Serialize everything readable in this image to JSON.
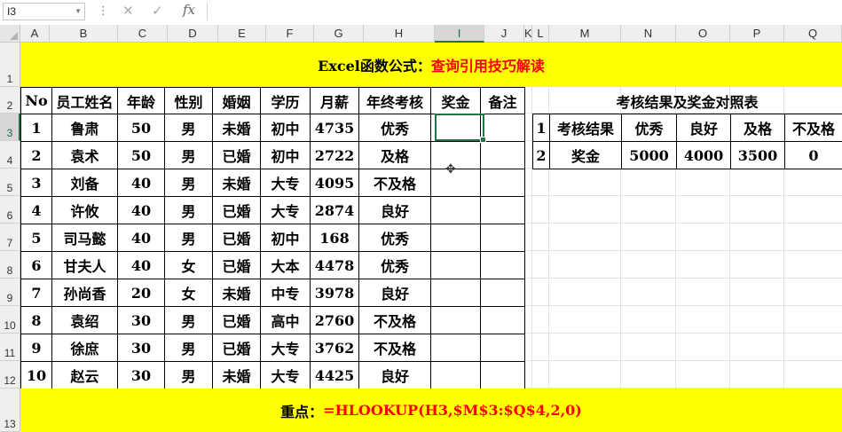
{
  "formula_bar": {
    "name_box": "I3",
    "cancel_glyph": "✕",
    "enter_glyph": "✓",
    "fx_glyph": "fx",
    "formula": ""
  },
  "columns": [
    "A",
    "B",
    "C",
    "D",
    "E",
    "F",
    "G",
    "H",
    "I",
    "J",
    "K",
    "L",
    "M",
    "N",
    "O",
    "P",
    "Q"
  ],
  "selected_column": "I",
  "rows": [
    "1",
    "2",
    "3",
    "4",
    "5",
    "6",
    "7",
    "8",
    "9",
    "10",
    "11",
    "12",
    "13"
  ],
  "selected_row": "3",
  "title": {
    "black": "Excel函数公式：",
    "red": "查询引用技巧解读"
  },
  "footer": {
    "black": "重点：",
    "red": "=HLOOKUP(H3,$M$3:$Q$4,2,0)"
  },
  "main_table": {
    "headers": [
      "No",
      "员工姓名",
      "年龄",
      "性别",
      "婚姻",
      "学历",
      "月薪",
      "年终考核",
      "奖金",
      "备注"
    ],
    "rows": [
      [
        "1",
        "鲁肃",
        "50",
        "男",
        "未婚",
        "初中",
        "4735",
        "优秀",
        "",
        ""
      ],
      [
        "2",
        "袁术",
        "50",
        "男",
        "已婚",
        "初中",
        "2722",
        "及格",
        "",
        ""
      ],
      [
        "3",
        "刘备",
        "40",
        "男",
        "未婚",
        "大专",
        "4095",
        "不及格",
        "",
        ""
      ],
      [
        "4",
        "许攸",
        "40",
        "男",
        "已婚",
        "大专",
        "2874",
        "良好",
        "",
        ""
      ],
      [
        "5",
        "司马懿",
        "40",
        "男",
        "已婚",
        "初中",
        "168",
        "优秀",
        "",
        ""
      ],
      [
        "6",
        "甘夫人",
        "40",
        "女",
        "已婚",
        "大本",
        "4478",
        "优秀",
        "",
        ""
      ],
      [
        "7",
        "孙尚香",
        "20",
        "女",
        "未婚",
        "中专",
        "3978",
        "良好",
        "",
        ""
      ],
      [
        "8",
        "袁绍",
        "30",
        "男",
        "已婚",
        "高中",
        "2760",
        "不及格",
        "",
        ""
      ],
      [
        "9",
        "徐庶",
        "30",
        "男",
        "已婚",
        "大专",
        "3762",
        "不及格",
        "",
        ""
      ],
      [
        "10",
        "赵云",
        "30",
        "男",
        "未婚",
        "大专",
        "4425",
        "良好",
        "",
        ""
      ]
    ]
  },
  "lookup_table": {
    "title": "考核结果及奖金对照表",
    "rows": [
      [
        "1",
        "考核结果",
        "优秀",
        "良好",
        "及格",
        "不及格"
      ],
      [
        "2",
        "奖金",
        "5000",
        "4000",
        "3500",
        "0"
      ]
    ]
  },
  "cursor_glyph": "✥"
}
